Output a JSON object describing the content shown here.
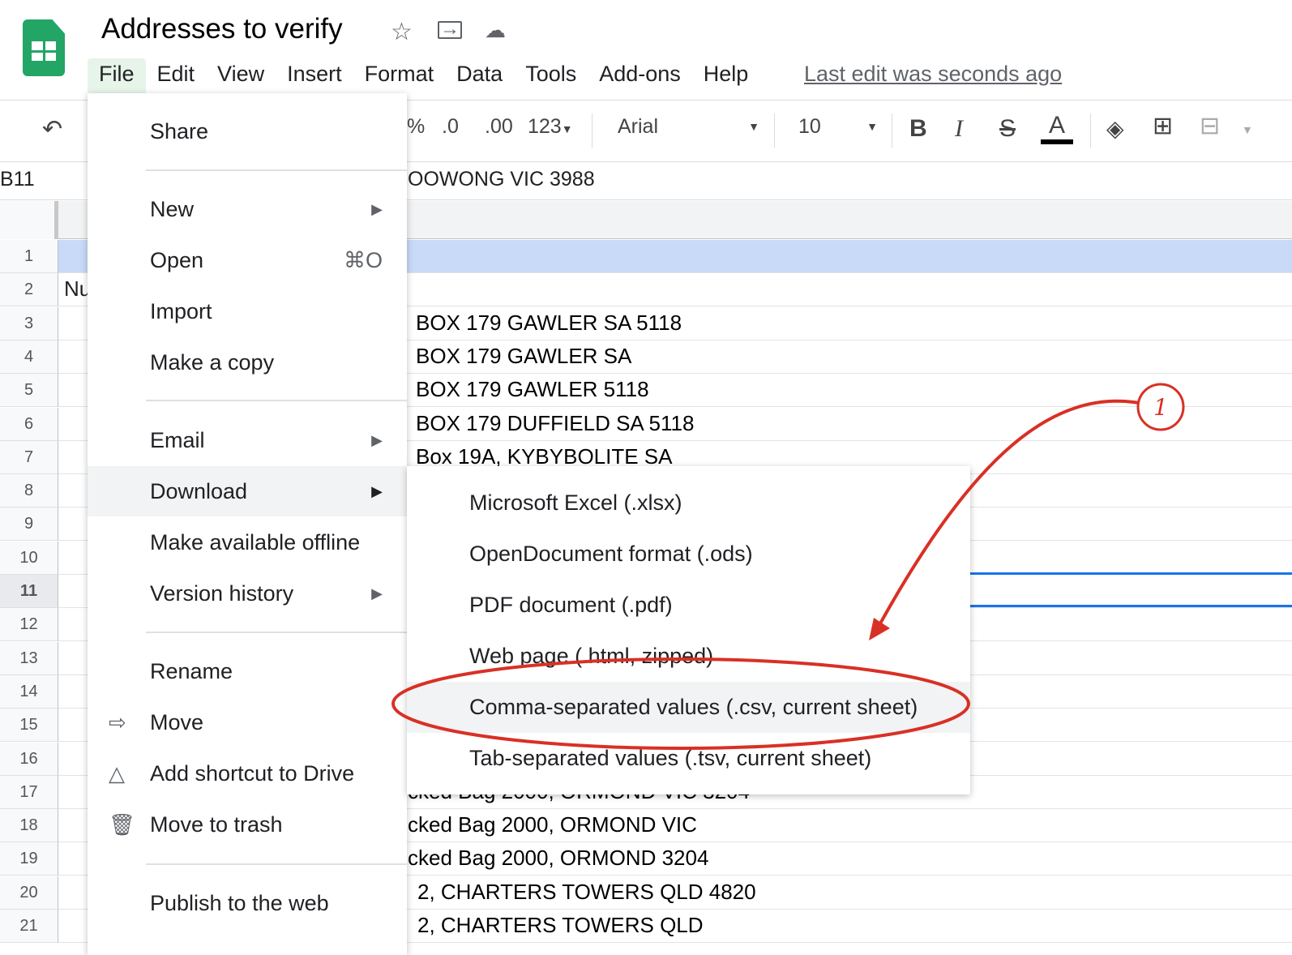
{
  "app": {
    "title": "Addresses to verify",
    "icons": [
      "star-icon",
      "move-to-folder-icon",
      "cloud-saved-icon"
    ]
  },
  "menubar": [
    "File",
    "Edit",
    "View",
    "Insert",
    "Format",
    "Data",
    "Tools",
    "Add-ons",
    "Help"
  ],
  "last_edit": "Last edit was seconds ago",
  "toolbar": {
    "percent": "%",
    "dec_less": ".0",
    "dec_more": ".00",
    "number_format": "123",
    "font": "Arial",
    "font_size": "10",
    "bold": "B",
    "italic": "I",
    "strike": "S",
    "text_color": "A",
    "text_color_hex": "#000000"
  },
  "formula_bar": {
    "cell_ref": "B11",
    "value": "OOWONG VIC 3988"
  },
  "rows": [
    {
      "n": "1",
      "a": "",
      "b": ""
    },
    {
      "n": "2",
      "a": "Nu",
      "b": ""
    },
    {
      "n": "3",
      "a": "",
      "b": "BOX 179 GAWLER SA 5118"
    },
    {
      "n": "4",
      "a": "",
      "b": "BOX 179 GAWLER SA"
    },
    {
      "n": "5",
      "a": "",
      "b": "BOX 179 GAWLER 5118"
    },
    {
      "n": "6",
      "a": "",
      "b": "BOX 179 DUFFIELD SA 5118"
    },
    {
      "n": "7",
      "a": "",
      "b": "Box 19A, KYBYBOLITE SA"
    },
    {
      "n": "8",
      "a": "",
      "b": ""
    },
    {
      "n": "9",
      "a": "",
      "b": ""
    },
    {
      "n": "10",
      "a": "",
      "b": ""
    },
    {
      "n": "11",
      "a": "",
      "b": ""
    },
    {
      "n": "12",
      "a": "",
      "b": ""
    },
    {
      "n": "13",
      "a": "",
      "b": ""
    },
    {
      "n": "14",
      "a": "",
      "b": ""
    },
    {
      "n": "15",
      "a": "",
      "b": ""
    },
    {
      "n": "16",
      "a": "",
      "b": ""
    },
    {
      "n": "17",
      "a": "",
      "b": "cked Bag 2000, ORMOND VIC 3204"
    },
    {
      "n": "18",
      "a": "",
      "b": "cked Bag 2000, ORMOND VIC"
    },
    {
      "n": "19",
      "a": "",
      "b": "cked Bag 2000, ORMOND 3204"
    },
    {
      "n": "20",
      "a": "",
      "b": "2, CHARTERS TOWERS QLD 4820"
    },
    {
      "n": "21",
      "a": "",
      "b": "2, CHARTERS TOWERS QLD"
    }
  ],
  "file_menu": {
    "share": "Share",
    "new": "New",
    "open": "Open",
    "open_shortcut": "⌘O",
    "import": "Import",
    "copy": "Make a copy",
    "email": "Email",
    "download": "Download",
    "offline": "Make available offline",
    "version": "Version history",
    "rename": "Rename",
    "move": "Move",
    "shortcut": "Add shortcut to Drive",
    "trash": "Move to trash",
    "publish": "Publish to the web"
  },
  "download_menu": [
    "Microsoft Excel (.xlsx)",
    "OpenDocument format (.ods)",
    "PDF document (.pdf)",
    "Web page (.html, zipped)",
    "Comma-separated values (.csv, current sheet)",
    "Tab-separated values (.tsv, current sheet)"
  ],
  "annotation": {
    "step": "1",
    "color": "#d93025"
  },
  "colors": {
    "accent": "#1a73e8",
    "sheets_green": "#23a566"
  }
}
